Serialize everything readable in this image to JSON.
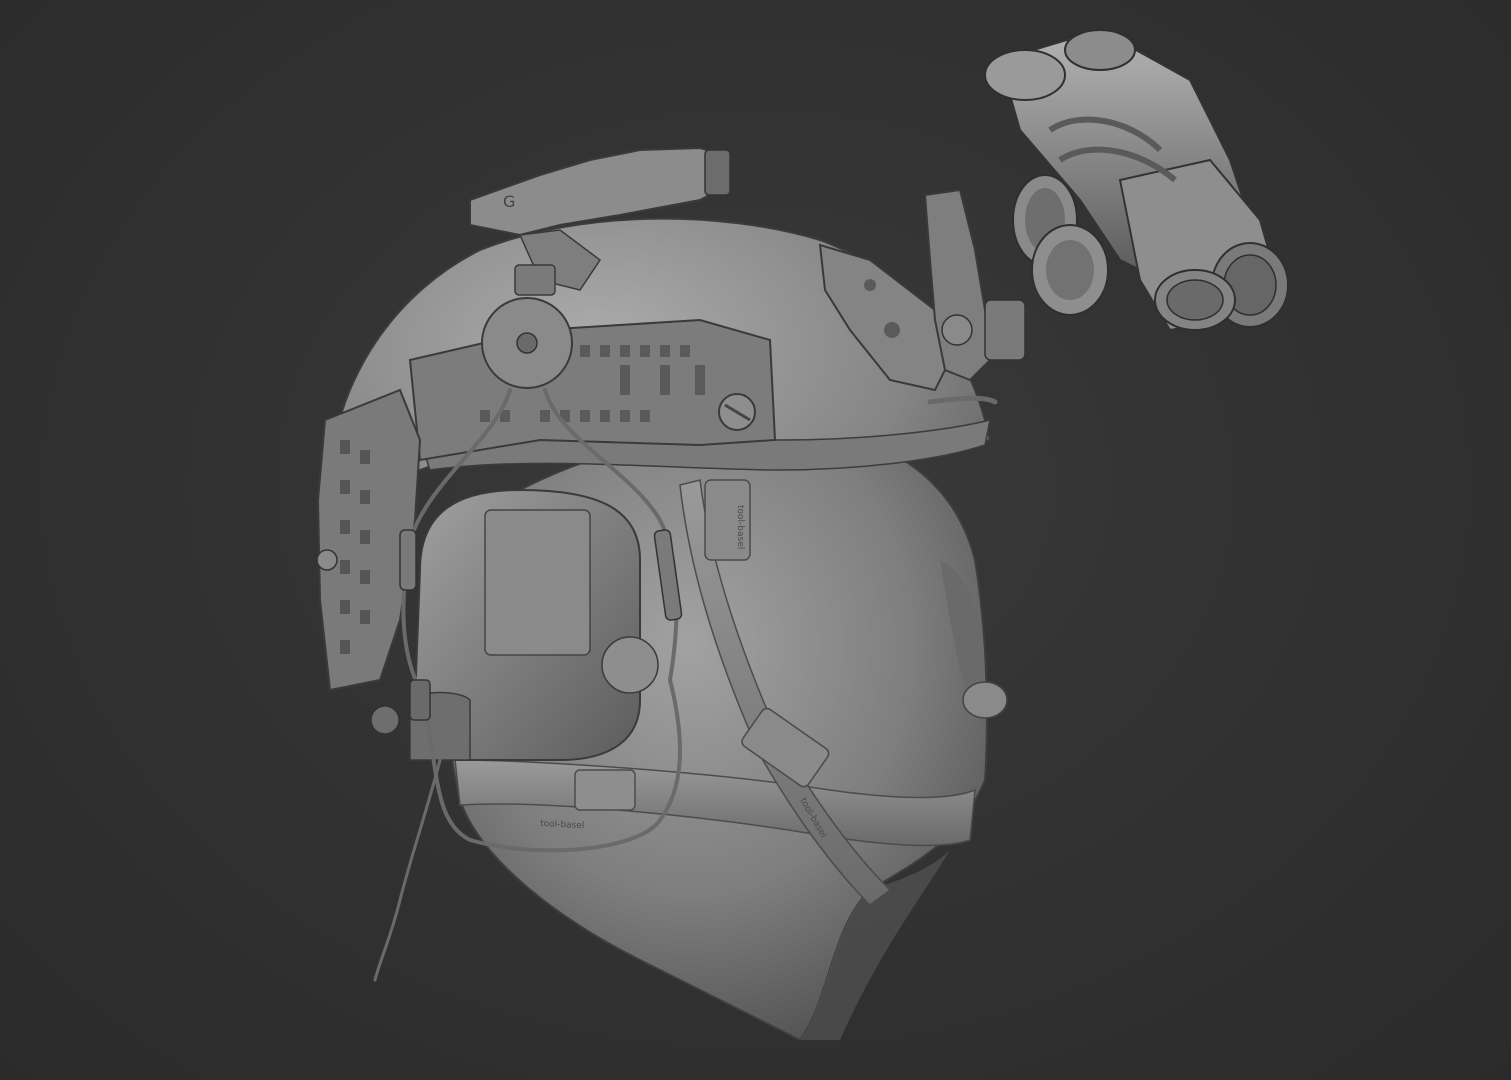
{
  "scene": {
    "background_color": "#303030",
    "material_color": "#8c8c8c",
    "subject": "sculpted tactical helmet on head bust",
    "strap_labels": [
      "tool-basel",
      "tool-basel",
      "tool-basel"
    ]
  }
}
